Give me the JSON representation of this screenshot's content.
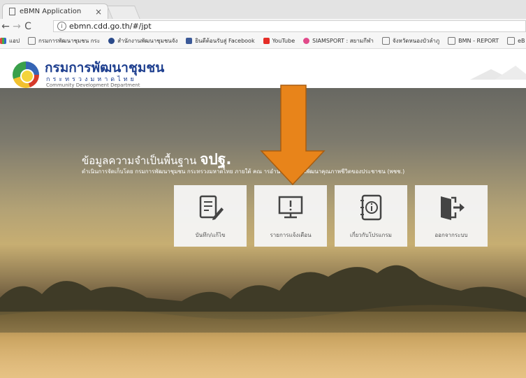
{
  "browser": {
    "tab_title": "eBMN Application",
    "tab_close": "×",
    "url": "ebmn.cdd.go.th/#/jpt",
    "bookmarks": [
      {
        "label": "แอป",
        "icon": "apps-grid-icon"
      },
      {
        "label": "กรมการพัฒนาชุมชน กระ",
        "icon": "page-icon"
      },
      {
        "label": "สำนักงานพัฒนาชุมชนจัง",
        "icon": "site-icon"
      },
      {
        "label": "ยินดีต้อนรับสู่ Facebook",
        "icon": "facebook-icon"
      },
      {
        "label": "YouTube",
        "icon": "youtube-icon"
      },
      {
        "label": "SIAMSPORT : สยามกีฬา",
        "icon": "siamsport-icon"
      },
      {
        "label": "จังหวัดหนองบัวลำภู",
        "icon": "page-icon"
      },
      {
        "label": "BMN - REPORT",
        "icon": "page-icon"
      },
      {
        "label": "eB",
        "icon": "page-icon"
      }
    ]
  },
  "header": {
    "org_name_th": "กรมการพัฒนาชุมชน",
    "ministry_th": "กระทรวงมหาดไทย",
    "org_name_en": "Community Development Department"
  },
  "hero": {
    "title_prefix": "ข้อมูลความจำเป็นพื้นฐาน",
    "title_bold": "จปฐ.",
    "subtitle": "ดำเนินการจัดเก็บโดย กรมการพัฒนาชุมชน กระทรวงมหาดไทย ภายใต้ คณ                    ารอำนวยการงานพัฒนาคุณภาพชีวิตของประชาชน (พชช.)"
  },
  "tiles": [
    {
      "label": "บันทึก/แก้ไข",
      "icon": "edit-document-icon"
    },
    {
      "label": "รายการแจ้งเตือน",
      "icon": "alert-monitor-icon"
    },
    {
      "label": "เกี่ยวกับโปรแกรม",
      "icon": "info-notebook-icon"
    },
    {
      "label": "ออกจากระบบ",
      "icon": "logout-door-icon"
    }
  ],
  "colors": {
    "accent": "#e8841a",
    "brand_blue": "#1e3f8f",
    "tile_bg": "#f5f5f5"
  }
}
